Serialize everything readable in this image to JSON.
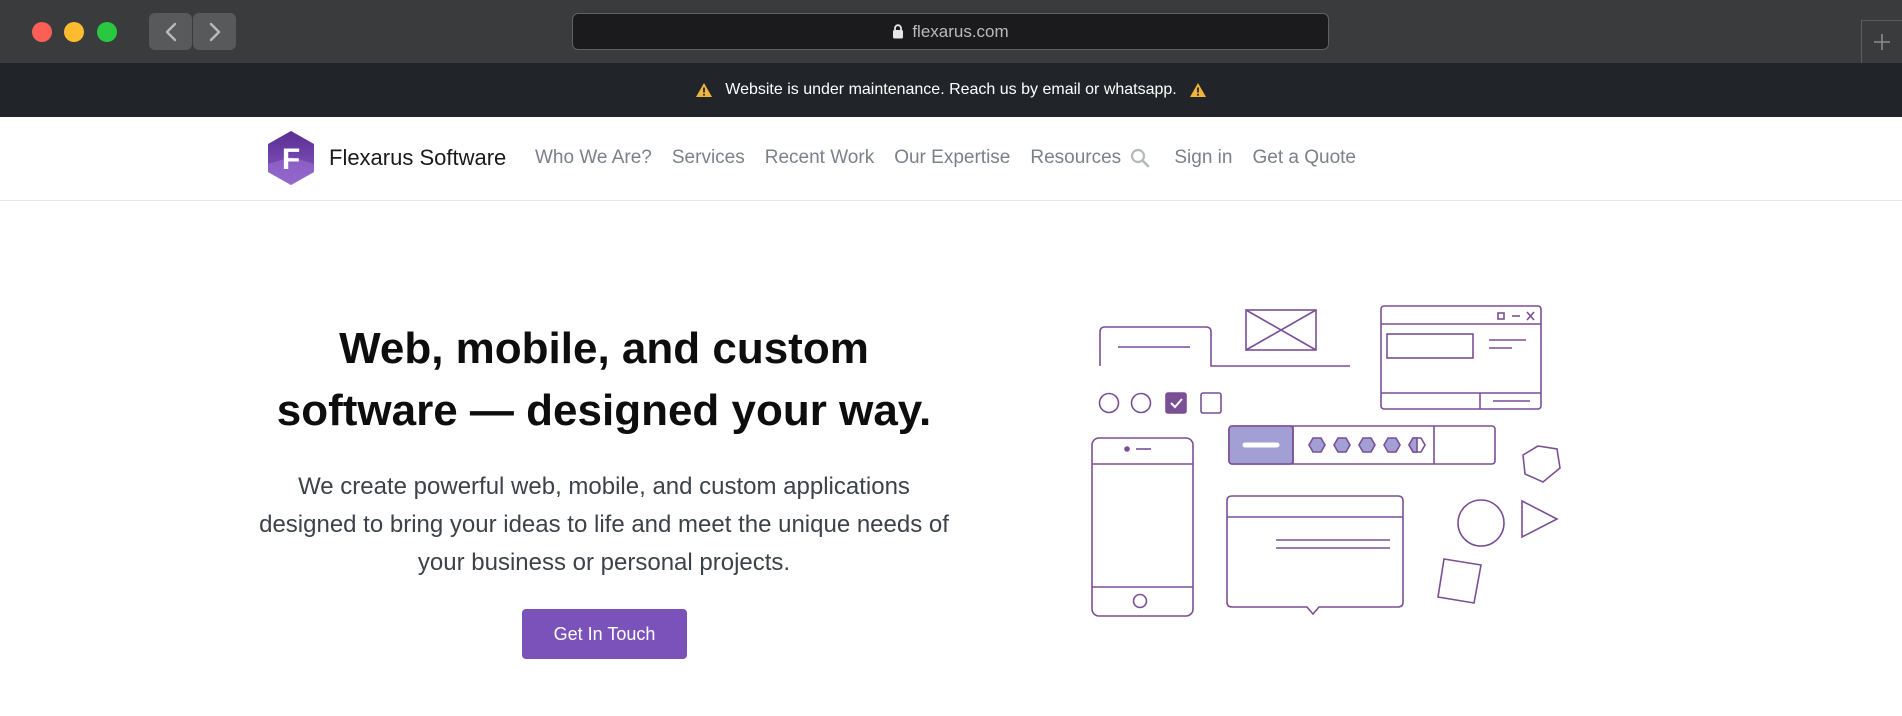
{
  "browser": {
    "url": "flexarus.com"
  },
  "banner": {
    "text": "Website is under maintenance. Reach us by email or whatsapp."
  },
  "nav": {
    "brand": "Flexarus Software",
    "logo_letter": "F",
    "links": [
      "Who We Are?",
      "Services",
      "Recent Work",
      "Our Expertise",
      "Resources"
    ],
    "sign_in": "Sign in",
    "quote": "Get a Quote"
  },
  "hero": {
    "title_line1": "Web, mobile, and custom",
    "title_line2": "software — designed your way.",
    "subtitle": "We create powerful web, mobile, and custom applications designed to bring your ideas to life and meet the unique needs of your business or personal projects.",
    "cta": "Get In Touch"
  },
  "colors": {
    "accent": "#7b52b9",
    "illustration_stroke": "#7a4f95",
    "illustration_fill": "#a19fd3",
    "banner_bg": "#212529",
    "warning": "#f0b43c"
  }
}
